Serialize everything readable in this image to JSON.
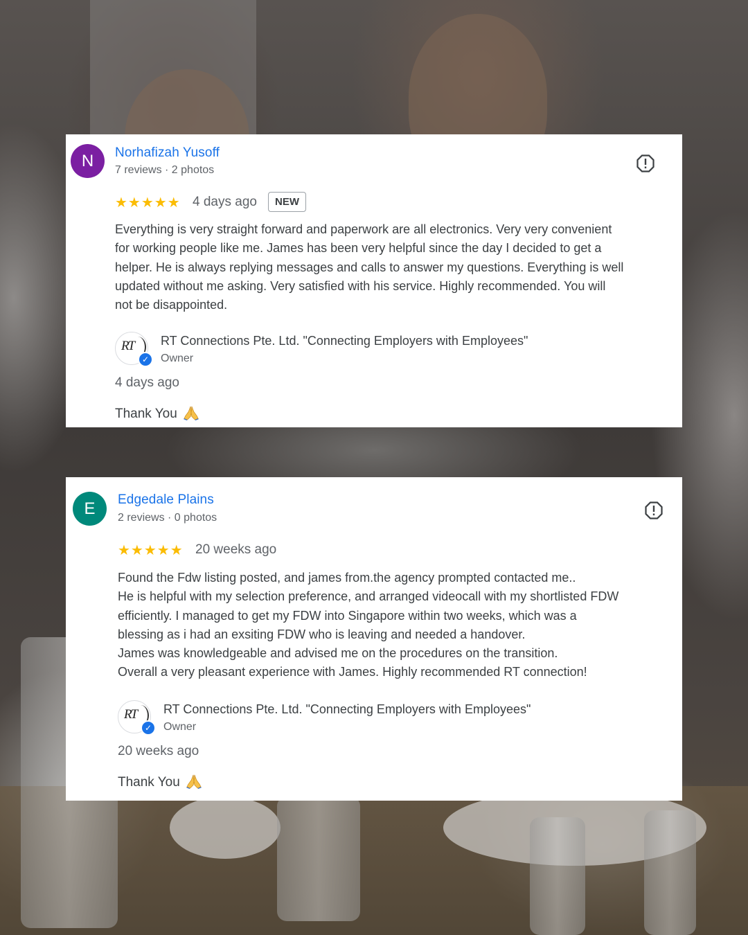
{
  "reviews": [
    {
      "avatar_letter": "N",
      "avatar_color": "#7b1fa2",
      "name": "Norhafizah Yusoff",
      "meta": "7 reviews · 2 photos",
      "stars": "★★★★★",
      "rating": 5,
      "date": "4 days ago",
      "badge": "NEW",
      "text_lines": [
        "Everything is very straight forward and paperwork are all electronics. Very very convenient",
        "for working people like me. James has been very helpful since the day I decided to get a",
        "helper. He is always replying messages and calls to answer my questions. Everything is well",
        "updated without me asking. Very satisfied with his service. Highly recommended. You will",
        "not be disappointed."
      ],
      "owner": {
        "logo_text": "RT",
        "name": "RT Connections Pte. Ltd. \"Connecting Employers with Employees\"",
        "role": "Owner",
        "reply_date": "4 days ago",
        "reply_text": "Thank You",
        "reply_emoji": "folded-hands-icon"
      }
    },
    {
      "avatar_letter": "E",
      "avatar_color": "#00897b",
      "name": "Edgedale Plains",
      "meta": "2 reviews · 0 photos",
      "stars": "★★★★★",
      "rating": 5,
      "date": "20 weeks ago",
      "text_lines": [
        "Found the Fdw listing posted, and james from.the agency prompted contacted me..",
        "He is helpful with my selection preference, and arranged videocall with my shortlisted FDW",
        "efficiently. I managed to get my FDW into Singapore within two weeks, which was a",
        "blessing as i had an exsiting FDW who is leaving and needed a handover.",
        "James was knowledgeable and advised me on the procedures on the transition.",
        "Overall a very pleasant experience with James. Highly recommended RT connection!"
      ],
      "owner": {
        "logo_text": "RT",
        "name": "RT Connections Pte. Ltd. \"Connecting Employers with Employees\"",
        "role": "Owner",
        "reply_date": "20 weeks ago",
        "reply_text": "Thank You",
        "reply_emoji": "folded-hands-icon"
      }
    }
  ],
  "icons": {
    "report": "report-flag-icon",
    "verified": "verified-check-icon"
  },
  "colors": {
    "link_blue": "#1a73e8",
    "star_yellow": "#fbbc04",
    "text_gray": "#3c4043",
    "meta_gray": "#5f6368"
  }
}
